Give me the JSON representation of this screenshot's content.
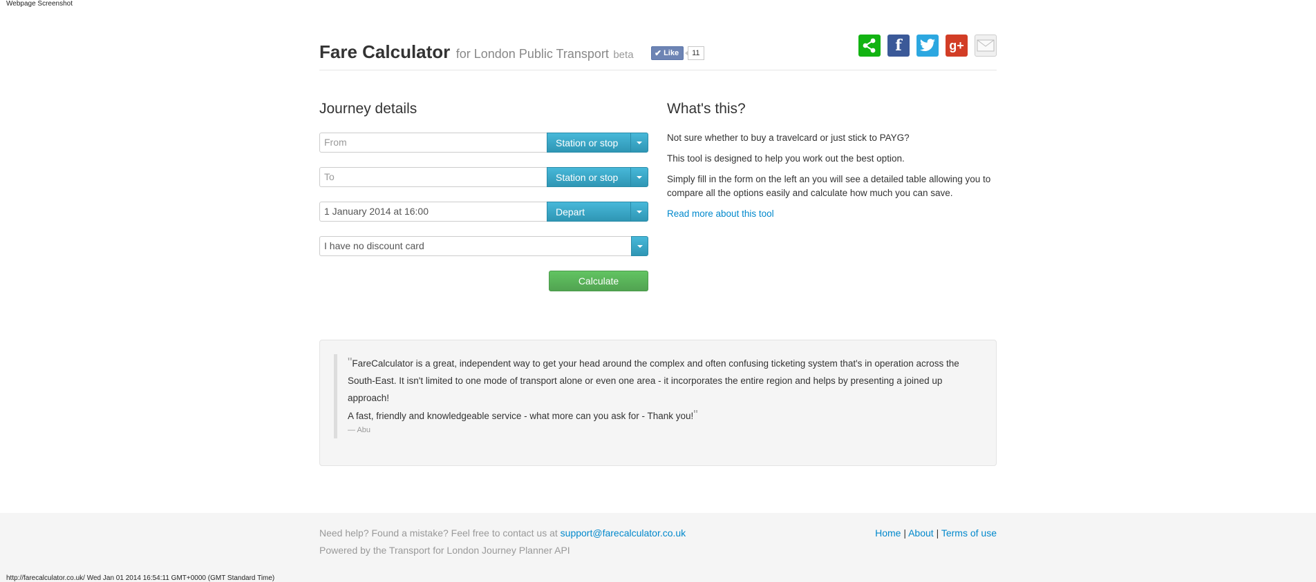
{
  "screenshot_label": "Webpage Screenshot",
  "header": {
    "title": "Fare Calculator",
    "subtitle": "for London Public Transport",
    "badge": "beta",
    "like_label": "Like",
    "like_count": "11",
    "social": [
      "share-icon",
      "facebook-icon",
      "twitter-icon",
      "google-plus-icon",
      "email-icon"
    ]
  },
  "journey": {
    "heading": "Journey details",
    "from_placeholder": "From",
    "from_type": "Station or stop",
    "to_placeholder": "To",
    "to_type": "Station or stop",
    "datetime_value": "1 January 2014 at 16:00",
    "depart_label": "Depart",
    "discount_value": "I have no discount card",
    "calculate_label": "Calculate"
  },
  "about": {
    "heading": "What's this?",
    "p1": "Not sure whether to buy a travelcard or just stick to PAYG?",
    "p2": "This tool is designed to help you work out the best option.",
    "p3": "Simply fill in the form on the left an you will see a detailed table allowing you to compare all the options easily and calculate how much you can save.",
    "link": "Read more about this tool"
  },
  "testimonial": {
    "open_mark": "\"",
    "text1": "FareCalculator is a great, independent way to get your head around the complex and often confusing ticketing system that's in operation across the South-East. It isn't limited to one mode of transport alone or even one area - it incorporates the entire region and helps by presenting a joined up approach!",
    "text2": "A fast, friendly and knowledgeable service - what more can you ask for - Thank you!",
    "close_mark": "\"",
    "author": "— Abu"
  },
  "footer": {
    "help_text": "Need help? Found a mistake? Feel free to contact us at",
    "email": "support@farecalculator.co.uk",
    "powered": "Powered by the Transport for London Journey Planner API",
    "links": [
      "Home",
      "About",
      "Terms of use"
    ],
    "separator": "|"
  },
  "status_bar": "http://farecalculator.co.uk/ Wed Jan 01 2014 16:54:11 GMT+0000 (GMT Standard Time)",
  "colors": {
    "accent": "#2f96b4",
    "success": "#51a351",
    "link": "#0088cc"
  }
}
